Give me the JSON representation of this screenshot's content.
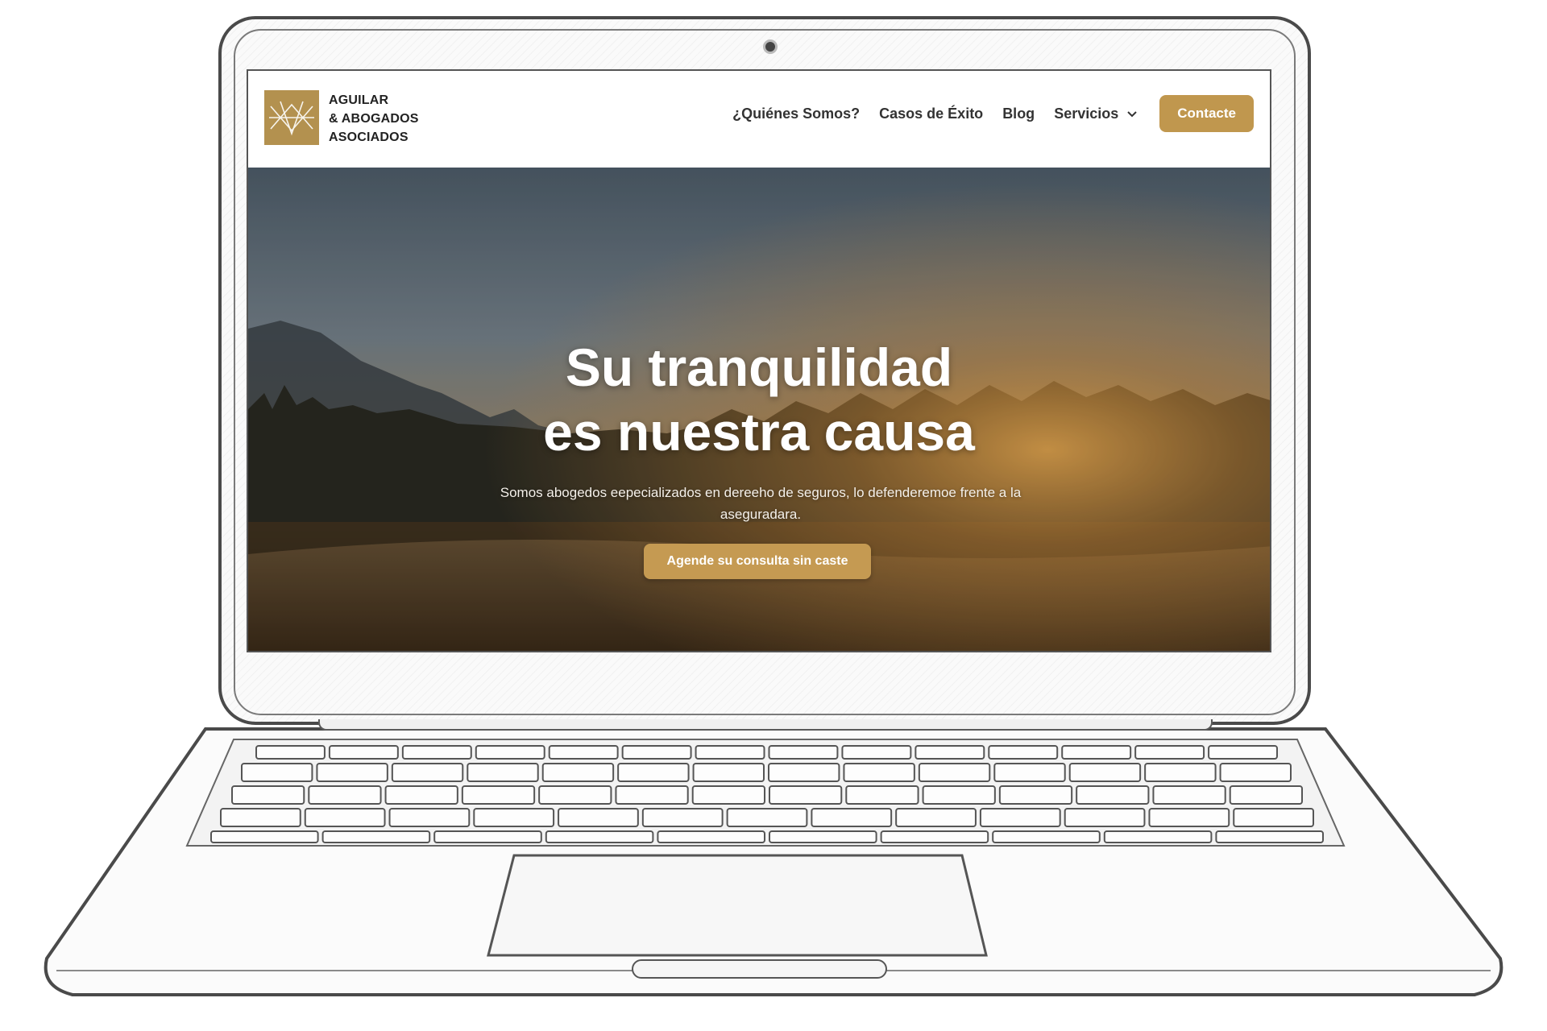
{
  "site": {
    "logo_lines": [
      "AGUILAR",
      "& ABOGADOS",
      "ASOCIADOS"
    ],
    "brand_color": "#b3914f"
  },
  "nav": {
    "items": [
      {
        "label": "¿Quiénes Somos?"
      },
      {
        "label": "Casos de Éxito"
      },
      {
        "label": "Blog"
      },
      {
        "label": "Servicios",
        "has_dropdown": true
      }
    ],
    "contact_label": "Contacte",
    "contact_color": "#c0974e"
  },
  "hero": {
    "title_lines": [
      "Su tranquilidad",
      "es nuestra causa"
    ],
    "subtitle": "Somos abogedos eepecializados en dereeho de seguros, lo defenderemoe frente a la aseguradara.",
    "cta_label": "Agende su consulta sin caste",
    "cta_color": "#c59a52"
  }
}
